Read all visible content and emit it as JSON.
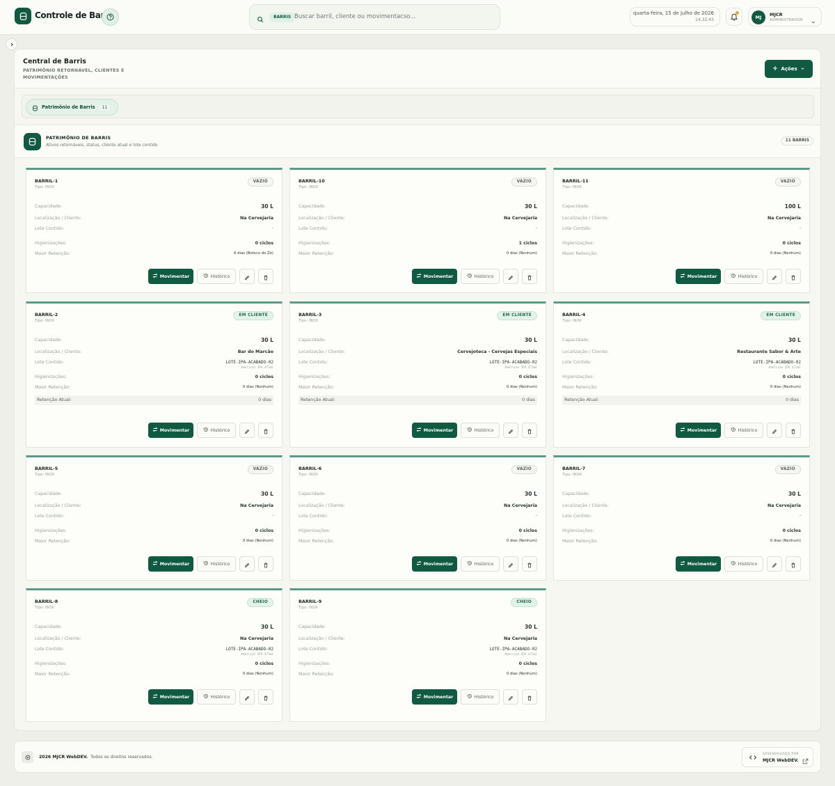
{
  "app": {
    "title": "Controle de Barris"
  },
  "search": {
    "tag": "BARRIS",
    "placeholder": "Buscar barril, cliente ou movimentacso..."
  },
  "header": {
    "date": "quarta-feira, 15 de julho de 2026",
    "time": "14:32:43"
  },
  "user": {
    "initials": "MJ",
    "name": "MJCR",
    "role": "ADMINISTRADOR"
  },
  "page": {
    "title": "Central de Barris",
    "subtitle": "PATRIMÔNIO RETORNÁVEL, CLIENTES E MOVIMENTAÇÕES",
    "actions_label": "Ações"
  },
  "tabs": [
    {
      "label": "Patrimônio de Barris",
      "count": "11"
    }
  ],
  "section": {
    "title": "PATRIMÔNIO DE BARRIS",
    "subtitle": "Ativos retornáveis, status, cliente atual e lote contido",
    "badge": "11 BARRIS"
  },
  "labels": {
    "capacity": "Capacidade:",
    "location": "Localização / Cliente:",
    "batch": "Lote Contido:",
    "cleanings": "Higienizações:",
    "max_retention": "Maior Retenção:",
    "current_retention": "Retenção Atual:",
    "move": "Movimentar",
    "history": "Histórico"
  },
  "barrels": [
    {
      "id": "BARRIL-1",
      "type": "Tipo: INOX",
      "status": "VAZIO",
      "status_kind": "vazio",
      "capacity": "30 L",
      "location": "Na Cervejaria",
      "batch": "-",
      "batch_sub": "",
      "cleanings": "0 ciclos",
      "max_retention": "6 dias (Boteco do Zé)",
      "current_retention": ""
    },
    {
      "id": "BARRIL-10",
      "type": "Tipo: INOX",
      "status": "VAZIO",
      "status_kind": "vazio",
      "capacity": "30 L",
      "location": "Na Cervejaria",
      "batch": "-",
      "batch_sub": "",
      "cleanings": "1 ciclos",
      "max_retention": "0 dias (Nenhum)",
      "current_retention": ""
    },
    {
      "id": "BARRIL-11",
      "type": "Tipo: INOX",
      "status": "VAZIO",
      "status_kind": "vazio",
      "capacity": "100 L",
      "location": "Na Cervejaria",
      "batch": "-",
      "batch_sub": "",
      "cleanings": "0 ciclos",
      "max_retention": "0 dias (Nenhum)",
      "current_retention": ""
    },
    {
      "id": "BARRIL-2",
      "type": "Tipo: INOX",
      "status": "EM CLIENTE",
      "status_kind": "cliente",
      "capacity": "30 L",
      "location": "Bar do Marcão",
      "batch": "LOTE-IPA-ACABADO-02",
      "batch_sub": "American IPA 473ml",
      "cleanings": "0 ciclos",
      "max_retention": "0 dias (Nenhum)",
      "current_retention": "0 dias"
    },
    {
      "id": "BARRIL-3",
      "type": "Tipo: INOX",
      "status": "EM CLIENTE",
      "status_kind": "cliente",
      "capacity": "30 L",
      "location": "Cervejoteca - Cervejas Especiais",
      "batch": "LOTE-IPA-ACABADO-02",
      "batch_sub": "American IPA 473ml",
      "cleanings": "0 ciclos",
      "max_retention": "0 dias (Nenhum)",
      "current_retention": "0 dias"
    },
    {
      "id": "BARRIL-4",
      "type": "Tipo: INOX",
      "status": "EM CLIENTE",
      "status_kind": "cliente",
      "capacity": "30 L",
      "location": "Restaurante Sabor & Arte",
      "batch": "LOTE-IPA-ACABADO-02",
      "batch_sub": "American IPA 473ml",
      "cleanings": "0 ciclos",
      "max_retention": "0 dias (Nenhum)",
      "current_retention": "0 dias"
    },
    {
      "id": "BARRIL-5",
      "type": "Tipo: INOX",
      "status": "VAZIO",
      "status_kind": "vazio",
      "capacity": "30 L",
      "location": "Na Cervejaria",
      "batch": "-",
      "batch_sub": "",
      "cleanings": "0 ciclos",
      "max_retention": "0 dias (Nenhum)",
      "current_retention": ""
    },
    {
      "id": "BARRIL-6",
      "type": "Tipo: INOX",
      "status": "VAZIO",
      "status_kind": "vazio",
      "capacity": "30 L",
      "location": "Na Cervejaria",
      "batch": "-",
      "batch_sub": "",
      "cleanings": "0 ciclos",
      "max_retention": "0 dias (Nenhum)",
      "current_retention": ""
    },
    {
      "id": "BARRIL-7",
      "type": "Tipo: INOX",
      "status": "VAZIO",
      "status_kind": "vazio",
      "capacity": "30 L",
      "location": "Na Cervejaria",
      "batch": "-",
      "batch_sub": "",
      "cleanings": "0 ciclos",
      "max_retention": "0 dias (Nenhum)",
      "current_retention": ""
    },
    {
      "id": "BARRIL-8",
      "type": "Tipo: INOX",
      "status": "CHEIO",
      "status_kind": "cheio",
      "capacity": "30 L",
      "location": "Na Cervejaria",
      "batch": "LOTE-IPA-ACABADO-02",
      "batch_sub": "American IPA 473ml",
      "cleanings": "0 ciclos",
      "max_retention": "0 dias (Nenhum)",
      "current_retention": ""
    },
    {
      "id": "BARRIL-9",
      "type": "Tipo: INOX",
      "status": "CHEIO",
      "status_kind": "cheio",
      "capacity": "30 L",
      "location": "Na Cervejaria",
      "batch": "LOTE-IPA-ACABADO-02",
      "batch_sub": "American IPA 473ml",
      "cleanings": "0 ciclos",
      "max_retention": "0 dias (Nenhum)",
      "current_retention": ""
    }
  ],
  "footer": {
    "brand": "2026 MJCR WebDEV.",
    "rights": "Todos os direitos reservados.",
    "dev_label": "DESENVOLVIDO POR",
    "dev_name": "MJCR WebDEV."
  },
  "colors": {
    "primary": "#0f5a40",
    "accent_top": "#5b9a86",
    "notification": "#e9a524"
  },
  "icons": [
    "barrel-icon",
    "help-icon",
    "search-icon",
    "bell-icon",
    "chevron-down-icon",
    "chevron-right-icon",
    "plus-icon",
    "swap-icon",
    "history-icon",
    "edit-icon",
    "trash-icon",
    "code-icon",
    "external-link-icon"
  ]
}
